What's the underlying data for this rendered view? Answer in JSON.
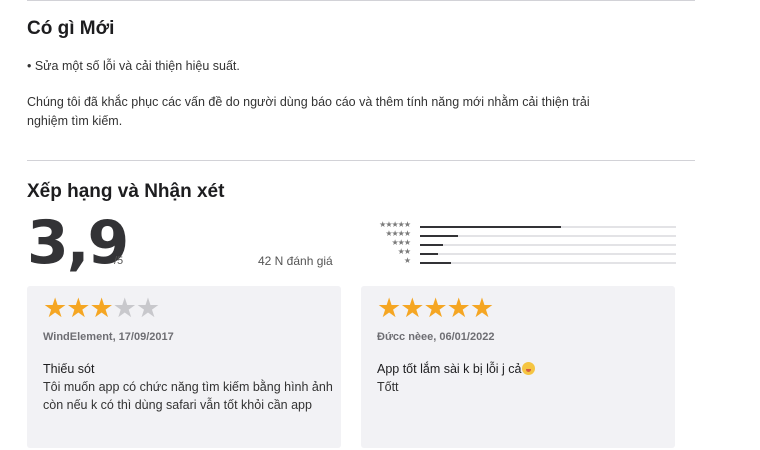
{
  "whats_new": {
    "title": "Có gì Mới",
    "bullet": "• Sửa một số lỗi và cải thiện hiệu suất.",
    "para_line1": "Chúng tôi đã khắc phục các vấn đề do người dùng báo cáo và thêm tính năng mới nhằm cải thiện trải",
    "para_line2": "nghiệm tìm kiếm."
  },
  "ratings": {
    "title": "Xếp hạng và Nhận xét",
    "score": "3,9",
    "out_of": "/5",
    "count": "42 N đánh giá",
    "histogram": [
      {
        "stars": 5,
        "label": "★★★★★",
        "fraction": 0.55
      },
      {
        "stars": 4,
        "label": "★★★★",
        "fraction": 0.15
      },
      {
        "stars": 3,
        "label": "★★★",
        "fraction": 0.09
      },
      {
        "stars": 2,
        "label": "★★",
        "fraction": 0.07
      },
      {
        "stars": 1,
        "label": "★",
        "fraction": 0.12
      }
    ]
  },
  "reviews": [
    {
      "rating": 3,
      "meta": "WindElement, 17/09/2017",
      "title": "Thiếu sót",
      "body": "Tôi muốn app có chức năng tìm kiếm bằng hình ảnh còn nếu k có thì dùng safari vẫn tốt khỏi cần app"
    },
    {
      "rating": 5,
      "meta": "Đứcc nèee, 06/01/2022",
      "title": "App tốt lắm sài k bị lỗi j cả",
      "emoji": "face-savoring-food-emoji",
      "body": "Tốtt"
    }
  ],
  "colors": {
    "star": "#f5a623",
    "star_empty": "#c8c8cc",
    "card_bg": "#f2f2f5",
    "bar": "#333336"
  }
}
